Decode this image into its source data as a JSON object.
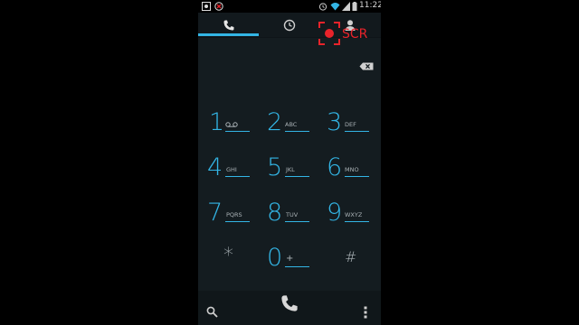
{
  "status": {
    "time": "11:22"
  },
  "tabs": [
    {
      "name": "dialpad",
      "icon": "phone-icon",
      "active": true
    },
    {
      "name": "recents",
      "icon": "clock-icon",
      "active": false
    },
    {
      "name": "contacts",
      "icon": "person-icon",
      "active": false
    }
  ],
  "keys": [
    {
      "digit": "1",
      "letters": ""
    },
    {
      "digit": "2",
      "letters": "ABC"
    },
    {
      "digit": "3",
      "letters": "DEF"
    },
    {
      "digit": "4",
      "letters": "GHI"
    },
    {
      "digit": "5",
      "letters": "JKL"
    },
    {
      "digit": "6",
      "letters": "MNO"
    },
    {
      "digit": "7",
      "letters": "PQRS"
    },
    {
      "digit": "8",
      "letters": "TUV"
    },
    {
      "digit": "9",
      "letters": "WXYZ"
    },
    {
      "digit": "*",
      "letters": ""
    },
    {
      "digit": "0",
      "letters": "+"
    },
    {
      "digit": "#",
      "letters": ""
    }
  ],
  "overlay": {
    "label": "SCR",
    "color": "#e8232a"
  },
  "colors": {
    "accent": "#33b5e5",
    "background": "#141c20"
  }
}
